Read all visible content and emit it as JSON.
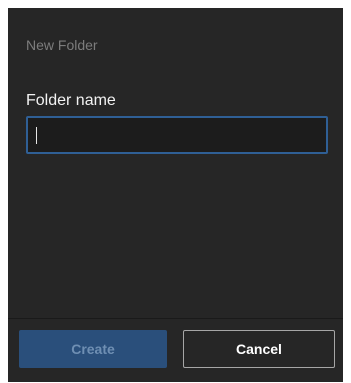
{
  "dialog": {
    "title": "New Folder",
    "field_label": "Folder name",
    "input_value": "",
    "create_label": "Create",
    "cancel_label": "Cancel"
  },
  "colors": {
    "background": "#262626",
    "input_border": "#2f5f95",
    "primary_button": "#2a4f7b",
    "primary_button_text": "#6f8fb3"
  }
}
